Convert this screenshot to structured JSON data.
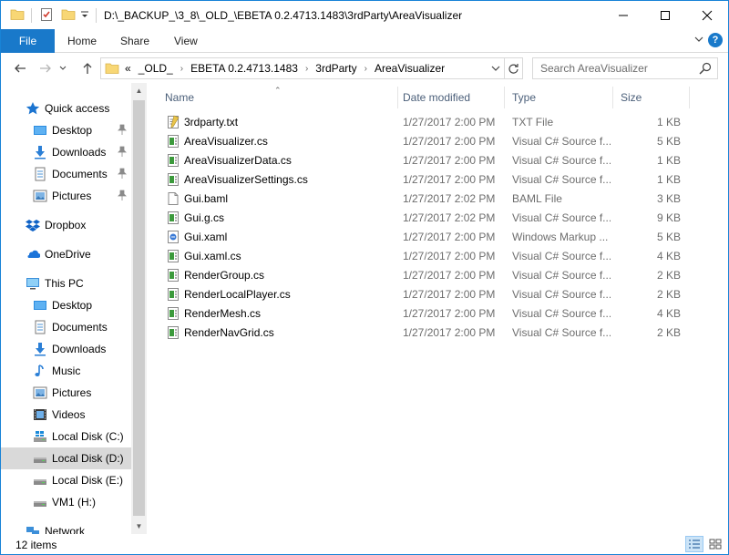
{
  "window": {
    "title": "D:\\_BACKUP_\\3_8\\_OLD_\\EBETA 0.2.4713.1483\\3rdParty\\AreaVisualizer"
  },
  "ribbon": {
    "file": "File",
    "tabs": [
      "Home",
      "Share",
      "View"
    ],
    "help": "?"
  },
  "address": {
    "overflow": "«",
    "crumbs": [
      "_OLD_",
      "EBETA 0.2.4713.1483",
      "3rdParty",
      "AreaVisualizer"
    ]
  },
  "search": {
    "placeholder": "Search AreaVisualizer"
  },
  "sidebar": {
    "items": [
      {
        "label": "Quick access",
        "icon": "star-icon"
      },
      {
        "label": "Desktop",
        "icon": "desktop-icon"
      },
      {
        "label": "Downloads",
        "icon": "download-icon"
      },
      {
        "label": "Documents",
        "icon": "documents-icon"
      },
      {
        "label": "Pictures",
        "icon": "pictures-icon"
      },
      {
        "label": "Dropbox",
        "icon": "dropbox-icon"
      },
      {
        "label": "OneDrive",
        "icon": "onedrive-icon"
      },
      {
        "label": "This PC",
        "icon": "computer-icon"
      },
      {
        "label": "Desktop",
        "icon": "desktop-icon"
      },
      {
        "label": "Documents",
        "icon": "documents-icon"
      },
      {
        "label": "Downloads",
        "icon": "download-icon"
      },
      {
        "label": "Music",
        "icon": "music-icon"
      },
      {
        "label": "Pictures",
        "icon": "pictures-icon"
      },
      {
        "label": "Videos",
        "icon": "videos-icon"
      },
      {
        "label": "Local Disk (C:)",
        "icon": "windows-drive-icon"
      },
      {
        "label": "Local Disk (D:)",
        "icon": "drive-icon"
      },
      {
        "label": "Local Disk (E:)",
        "icon": "drive-icon"
      },
      {
        "label": "VM1 (H:)",
        "icon": "drive-icon"
      },
      {
        "label": "Network",
        "icon": "network-icon"
      }
    ],
    "selected": "Local Disk (D:)"
  },
  "columns": {
    "name": "Name",
    "date": "Date modified",
    "type": "Type",
    "size": "Size"
  },
  "files": [
    {
      "name": "3rdparty.txt",
      "date": "1/27/2017 2:00 PM",
      "type": "TXT File",
      "size": "1 KB",
      "icon": "text-file-icon"
    },
    {
      "name": "AreaVisualizer.cs",
      "date": "1/27/2017 2:00 PM",
      "type": "Visual C# Source f...",
      "size": "5 KB",
      "icon": "csharp-file-icon"
    },
    {
      "name": "AreaVisualizerData.cs",
      "date": "1/27/2017 2:00 PM",
      "type": "Visual C# Source f...",
      "size": "1 KB",
      "icon": "csharp-file-icon"
    },
    {
      "name": "AreaVisualizerSettings.cs",
      "date": "1/27/2017 2:00 PM",
      "type": "Visual C# Source f...",
      "size": "1 KB",
      "icon": "csharp-file-icon"
    },
    {
      "name": "Gui.baml",
      "date": "1/27/2017 2:02 PM",
      "type": "BAML File",
      "size": "3 KB",
      "icon": "blank-file-icon"
    },
    {
      "name": "Gui.g.cs",
      "date": "1/27/2017 2:02 PM",
      "type": "Visual C# Source f...",
      "size": "9 KB",
      "icon": "csharp-file-icon"
    },
    {
      "name": "Gui.xaml",
      "date": "1/27/2017 2:00 PM",
      "type": "Windows Markup ...",
      "size": "5 KB",
      "icon": "xaml-file-icon"
    },
    {
      "name": "Gui.xaml.cs",
      "date": "1/27/2017 2:00 PM",
      "type": "Visual C# Source f...",
      "size": "4 KB",
      "icon": "csharp-file-icon"
    },
    {
      "name": "RenderGroup.cs",
      "date": "1/27/2017 2:00 PM",
      "type": "Visual C# Source f...",
      "size": "2 KB",
      "icon": "csharp-file-icon"
    },
    {
      "name": "RenderLocalPlayer.cs",
      "date": "1/27/2017 2:00 PM",
      "type": "Visual C# Source f...",
      "size": "2 KB",
      "icon": "csharp-file-icon"
    },
    {
      "name": "RenderMesh.cs",
      "date": "1/27/2017 2:00 PM",
      "type": "Visual C# Source f...",
      "size": "4 KB",
      "icon": "csharp-file-icon"
    },
    {
      "name": "RenderNavGrid.cs",
      "date": "1/27/2017 2:00 PM",
      "type": "Visual C# Source f...",
      "size": "2 KB",
      "icon": "csharp-file-icon"
    }
  ],
  "status": {
    "count": "12 items"
  },
  "colors": {
    "accent": "#1979ca",
    "selected_row": "#d9d9d9",
    "header_text": "#4c607a",
    "secondary_text": "#6d6d6d"
  }
}
